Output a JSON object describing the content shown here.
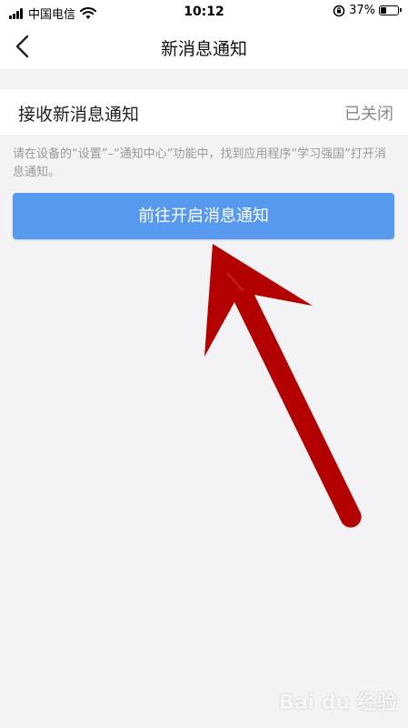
{
  "status_bar": {
    "carrier": "中国电信",
    "time": "10:12",
    "battery": "37%",
    "battery_level": 0.37
  },
  "nav": {
    "title": "新消息通知",
    "back_icon": "chevron-left-icon"
  },
  "setting": {
    "label": "接收新消息通知",
    "value": "已关闭"
  },
  "hint": "请在设备的“设置”–“通知中心”功能中，找到应用程序“学习强国”打开消息通知。",
  "button": {
    "label": "前往开启消息通知",
    "color": "#5699ee"
  },
  "annotation": {
    "arrow_color": "#b30000"
  },
  "watermark": "Bai du 经验"
}
